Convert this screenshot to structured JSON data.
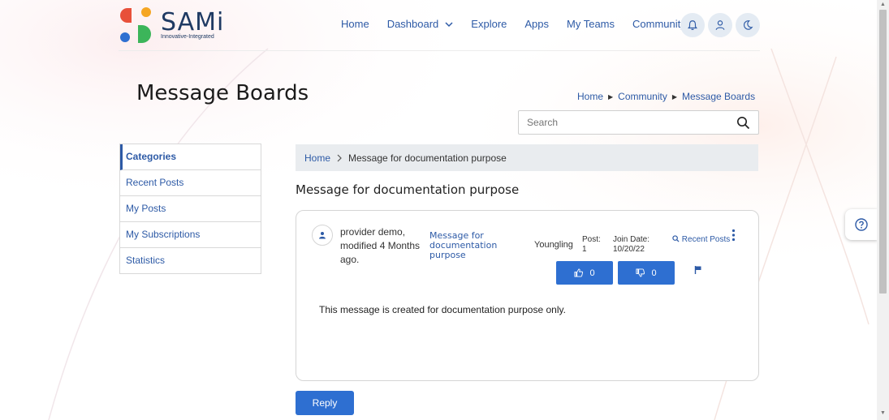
{
  "brand": {
    "name": "SAMi",
    "tagline": "Innovative-Integrated",
    "colors": {
      "red": "#e8503a",
      "orange": "#f5a623",
      "blue": "#2e6fd1",
      "green": "#3cb55a",
      "navy": "#1f3a63"
    }
  },
  "nav": {
    "items": [
      {
        "label": "Home"
      },
      {
        "label": "Dashboard",
        "dropdown": true
      },
      {
        "label": "Explore"
      },
      {
        "label": "Apps"
      },
      {
        "label": "My Teams"
      },
      {
        "label": "Community",
        "dropdown": true
      }
    ],
    "icons": [
      "bell-icon",
      "user-icon",
      "moon-icon"
    ]
  },
  "page": {
    "title": "Message Boards",
    "breadcrumb": [
      "Home",
      "Community",
      "Message Boards"
    ]
  },
  "search": {
    "placeholder": "Search"
  },
  "sidebar": {
    "items": [
      {
        "label": "Categories",
        "active": true
      },
      {
        "label": "Recent Posts"
      },
      {
        "label": "My Posts"
      },
      {
        "label": "My Subscriptions"
      },
      {
        "label": "Statistics"
      }
    ]
  },
  "thread": {
    "breadcrumb_home": "Home",
    "breadcrumb_current": "Message for documentation purpose",
    "title": "Message for documentation purpose"
  },
  "message": {
    "author": "provider demo,",
    "modified": "modified 4 Months ago.",
    "subject": "Message for documentation purpose",
    "rank": "Youngling",
    "post_label": "Post:",
    "post_count": "1",
    "join_label": "Join Date:",
    "join_date": "10/20/22",
    "recent_posts": "Recent Posts",
    "upvotes": "0",
    "downvotes": "0",
    "body": "This message is created for documentation purpose only."
  },
  "actions": {
    "reply": "Reply"
  },
  "accent_color": "#2e6fd1",
  "link_color": "#2d5aa6"
}
